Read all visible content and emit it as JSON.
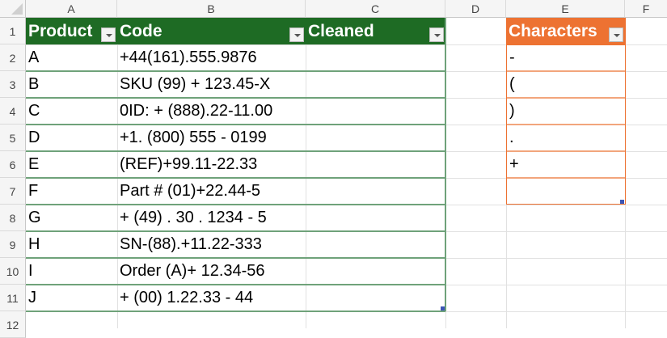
{
  "columns": [
    "A",
    "B",
    "C",
    "D",
    "E",
    "F"
  ],
  "row_numbers": [
    "1",
    "2",
    "3",
    "4",
    "5",
    "6",
    "7",
    "8",
    "9",
    "10",
    "11",
    "12"
  ],
  "table1": {
    "headers": [
      "Product",
      "Code",
      "Cleaned"
    ],
    "rows": [
      [
        "A",
        "+44(161).555.9876",
        ""
      ],
      [
        "B",
        "SKU (99) + 123.45-X",
        ""
      ],
      [
        "C",
        "0ID: + (888).22-11.00",
        ""
      ],
      [
        "D",
        "+1. (800) 555 - 0199",
        ""
      ],
      [
        "E",
        "(REF)+99.11-22.33",
        ""
      ],
      [
        "F",
        "Part # (01)+22.44-5",
        ""
      ],
      [
        "G",
        "+ (49) . 30 . 1234 - 5",
        ""
      ],
      [
        "H",
        "SN-(88).+11.22-333",
        ""
      ],
      [
        "I",
        "Order (A)+ 12.34-56",
        ""
      ],
      [
        "J",
        "+ (00) 1.22.33 - 44",
        ""
      ]
    ],
    "color": "#1e6b24",
    "line": "#6fa27a"
  },
  "table2": {
    "header": "Characters",
    "rows": [
      "-",
      "(",
      ")",
      ".",
      "+",
      ""
    ],
    "color": "#ed7232",
    "line": "#f2a57c"
  }
}
